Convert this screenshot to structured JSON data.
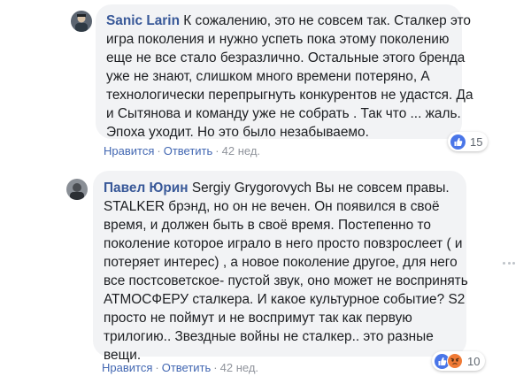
{
  "comments": [
    {
      "author": "Sanic Larin",
      "text_lines": [
        "К сожалению, это не совсем так. Сталкер это",
        "игра поколения и нужно успеть пока этому поколению",
        "еще не все стало безразлично. Остальные этого бренда",
        "уже не знают, слишком много времени потеряно, А",
        "технологически перепрыгнуть конкурентов не удастся. Да",
        "и Сытянова и команду уже не собрать . Так что ... жаль.",
        "Эпоха уходит. Но это было незабываемо."
      ],
      "actions": {
        "like": "Нравится",
        "reply": "Ответить",
        "time": "42 нед."
      },
      "reactions": {
        "icons": [
          "like-icon"
        ],
        "count": "15"
      }
    },
    {
      "author": "Павел Юрин",
      "mention": "Sergiy Grygorovych",
      "first_line_rest": "Вы не совсем правы.",
      "text_lines": [
        "STALKER брэнд, но он не вечен. Он появился в своё",
        "время, и должен быть в своё время. Постепенно то",
        "поколение которое играло в него просто повзрослеет ( и",
        "потеряет интерес) , а новое поколение другое, для него",
        "все постсоветское- пустой звук, оно может не воспринять",
        "АТМОСФЕРУ сталкера. И какое культурное событие? S2",
        "просто не поймут и не воспримут так как первую",
        "трилогию.. Звездные войны не сталкер.. это разные",
        "вещи."
      ],
      "actions": {
        "like": "Нравится",
        "reply": "Ответить",
        "time": "42 нед."
      },
      "reactions": {
        "icons": [
          "like-icon",
          "angry-icon"
        ],
        "count": "10"
      }
    }
  ],
  "colors": {
    "author": "#385898",
    "link": "#4267b2",
    "bubble": "#f2f3f5",
    "meta": "#90949c",
    "like": "#4a76e8",
    "angry": "#f07a35"
  }
}
